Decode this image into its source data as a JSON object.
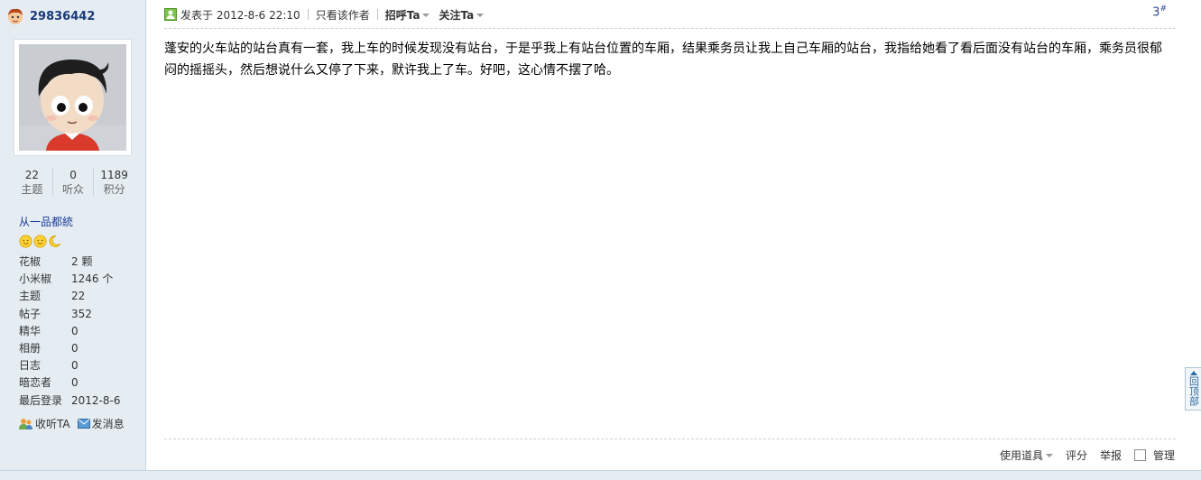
{
  "user": {
    "name": "29836442",
    "stats": [
      {
        "num": "22",
        "label": "主题"
      },
      {
        "num": "0",
        "label": "听众"
      },
      {
        "num": "1189",
        "label": "积分"
      }
    ],
    "group": "从一品都統",
    "info": [
      {
        "k": "花椒",
        "v": "2 颗"
      },
      {
        "k": "小米椒",
        "v": "1246 个"
      },
      {
        "k": "主题",
        "v": "22"
      },
      {
        "k": "帖子",
        "v": "352"
      },
      {
        "k": "精华",
        "v": "0"
      },
      {
        "k": "相册",
        "v": "0"
      },
      {
        "k": "日志",
        "v": "0"
      },
      {
        "k": "暗恋者",
        "v": "0"
      },
      {
        "k": "最后登录",
        "v": "2012-8-6"
      }
    ],
    "follow_label": "收听TA",
    "message_label": "发消息"
  },
  "post": {
    "posted_at": "发表于 2012-8-6 22:10",
    "only_author": "只看该作者",
    "greet": "招呼Ta",
    "follow": "关注Ta",
    "floor": "3",
    "floor_mark": "#",
    "content": "蓬安的火车站的站台真有一套，我上车的时候发现没有站台，于是乎我上有站台位置的车厢，结果乘务员让我上自己车厢的站台，我指给她看了看后面没有站台的车厢，乘务员很郁闷的摇摇头，然后想说什么又停了下来，默许我上了车。好吧，这心情不摆了哈。",
    "footer": {
      "tools": "使用道具",
      "rate": "评分",
      "report": "举报",
      "manage": "管理"
    }
  },
  "back_to_top": "回顶部"
}
